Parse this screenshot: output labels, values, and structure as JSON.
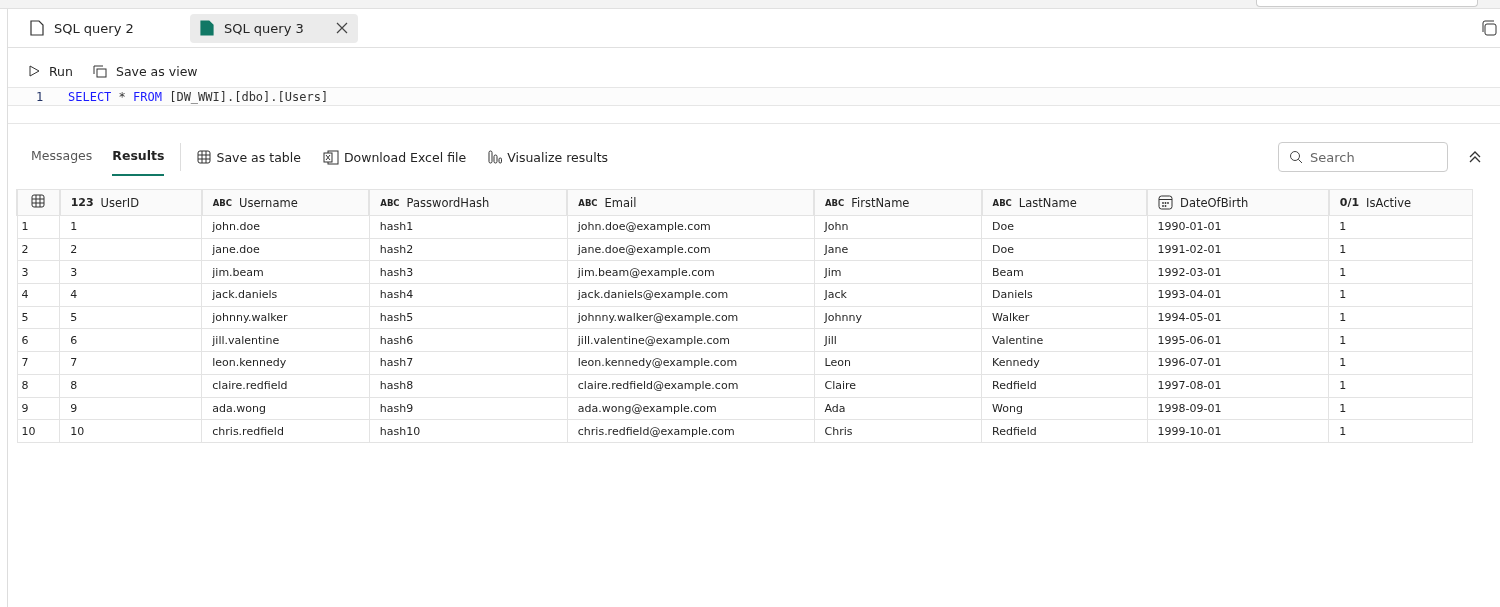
{
  "tabs": [
    {
      "label": "SQL query 2",
      "selected": false
    },
    {
      "label": "SQL query 3",
      "selected": true
    }
  ],
  "toolbar": {
    "run": "Run",
    "save_view": "Save as view"
  },
  "editor": {
    "line_number": "1",
    "code": [
      {
        "kind": "keyword",
        "text": "SELECT"
      },
      {
        "kind": "plain",
        "text": " * "
      },
      {
        "kind": "keyword",
        "text": "FROM"
      },
      {
        "kind": "plain",
        "text": " [DW_WWI].[dbo].[Users]"
      }
    ]
  },
  "result_tabs": [
    {
      "label": "Messages",
      "selected": false
    },
    {
      "label": "Results",
      "selected": true
    }
  ],
  "result_actions": [
    {
      "kind": "table",
      "label": "Save as table"
    },
    {
      "kind": "excel",
      "label": "Download Excel file"
    },
    {
      "kind": "chart",
      "label": "Visualize results"
    }
  ],
  "search": {
    "placeholder": "Search"
  },
  "table": {
    "columns": [
      {
        "name": "UserID",
        "kind": "number",
        "type_label": "123"
      },
      {
        "name": "Username",
        "kind": "text",
        "type_label": "ABC"
      },
      {
        "name": "PasswordHash",
        "kind": "text",
        "type_label": "ABC"
      },
      {
        "name": "Email",
        "kind": "text",
        "type_label": "ABC"
      },
      {
        "name": "FirstName",
        "kind": "text",
        "type_label": "ABC"
      },
      {
        "name": "LastName",
        "kind": "text",
        "type_label": "ABC"
      },
      {
        "name": "DateOfBirth",
        "kind": "date"
      },
      {
        "name": "IsActive",
        "kind": "bool",
        "type_label": "0/1"
      }
    ],
    "rows": [
      {
        "row_number": "1",
        "cells": [
          "1",
          "john.doe",
          "hash1",
          "john.doe@example.com",
          "John",
          "Doe",
          "1990-01-01",
          "1"
        ]
      },
      {
        "row_number": "2",
        "cells": [
          "2",
          "jane.doe",
          "hash2",
          "jane.doe@example.com",
          "Jane",
          "Doe",
          "1991-02-01",
          "1"
        ]
      },
      {
        "row_number": "3",
        "cells": [
          "3",
          "jim.beam",
          "hash3",
          "jim.beam@example.com",
          "Jim",
          "Beam",
          "1992-03-01",
          "1"
        ]
      },
      {
        "row_number": "4",
        "cells": [
          "4",
          "jack.daniels",
          "hash4",
          "jack.daniels@example.com",
          "Jack",
          "Daniels",
          "1993-04-01",
          "1"
        ]
      },
      {
        "row_number": "5",
        "cells": [
          "5",
          "johnny.walker",
          "hash5",
          "johnny.walker@example.com",
          "Johnny",
          "Walker",
          "1994-05-01",
          "1"
        ]
      },
      {
        "row_number": "6",
        "cells": [
          "6",
          "jill.valentine",
          "hash6",
          "jill.valentine@example.com",
          "Jill",
          "Valentine",
          "1995-06-01",
          "1"
        ]
      },
      {
        "row_number": "7",
        "cells": [
          "7",
          "leon.kennedy",
          "hash7",
          "leon.kennedy@example.com",
          "Leon",
          "Kennedy",
          "1996-07-01",
          "1"
        ]
      },
      {
        "row_number": "8",
        "cells": [
          "8",
          "claire.redfield",
          "hash8",
          "claire.redfield@example.com",
          "Claire",
          "Redfield",
          "1997-08-01",
          "1"
        ]
      },
      {
        "row_number": "9",
        "cells": [
          "9",
          "ada.wong",
          "hash9",
          "ada.wong@example.com",
          "Ada",
          "Wong",
          "1998-09-01",
          "1"
        ]
      },
      {
        "row_number": "10",
        "cells": [
          "10",
          "chris.redfield",
          "hash10",
          "chris.redfield@example.com",
          "Chris",
          "Redfield",
          "1999-10-01",
          "1"
        ]
      }
    ]
  }
}
